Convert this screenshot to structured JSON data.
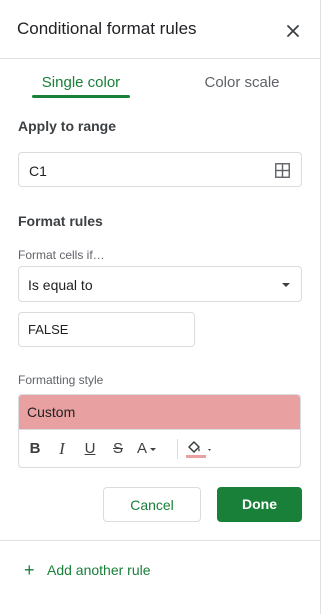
{
  "header": {
    "title": "Conditional format rules",
    "close_icon": "close-icon"
  },
  "tabs": [
    {
      "label": "Single color",
      "active": true
    },
    {
      "label": "Color scale",
      "active": false
    }
  ],
  "apply_range": {
    "label": "Apply to range",
    "value": "C1",
    "icon": "grid-icon"
  },
  "format_rules": {
    "label": "Format rules",
    "condition_label": "Format cells if…",
    "condition_value": "Is equal to",
    "value": "FALSE"
  },
  "formatting_style": {
    "label": "Formatting style",
    "preview_text": "Custom",
    "preview_color": "#e8a0a0",
    "tools": {
      "bold": "B",
      "italic": "I",
      "underline": "U",
      "strikethrough": "S",
      "text_color": "A"
    },
    "fill_color": "#e8a0a0"
  },
  "buttons": {
    "cancel": "Cancel",
    "done": "Done"
  },
  "add_rule": {
    "plus": "+",
    "label": "Add another rule"
  },
  "colors": {
    "accent": "#188038",
    "divider": "#e0e0e0"
  }
}
